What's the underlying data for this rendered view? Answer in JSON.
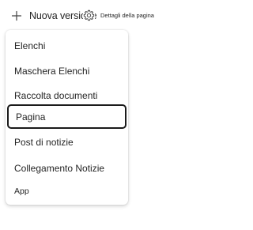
{
  "toolbar": {
    "new_label": "Nuova versione",
    "new_icon": "plus-icon",
    "details_label": "Dettagli della pagina",
    "details_icon": "gear-icon"
  },
  "menu": {
    "items": [
      {
        "label": "Elenchi"
      },
      {
        "label": "Maschera Elenchi"
      },
      {
        "label": "Raccolta documenti"
      },
      {
        "label": "Pagina",
        "selected": true
      },
      {
        "label": "Post di notizie"
      },
      {
        "label": "Collegamento Notizie"
      },
      {
        "label": "App"
      }
    ]
  }
}
